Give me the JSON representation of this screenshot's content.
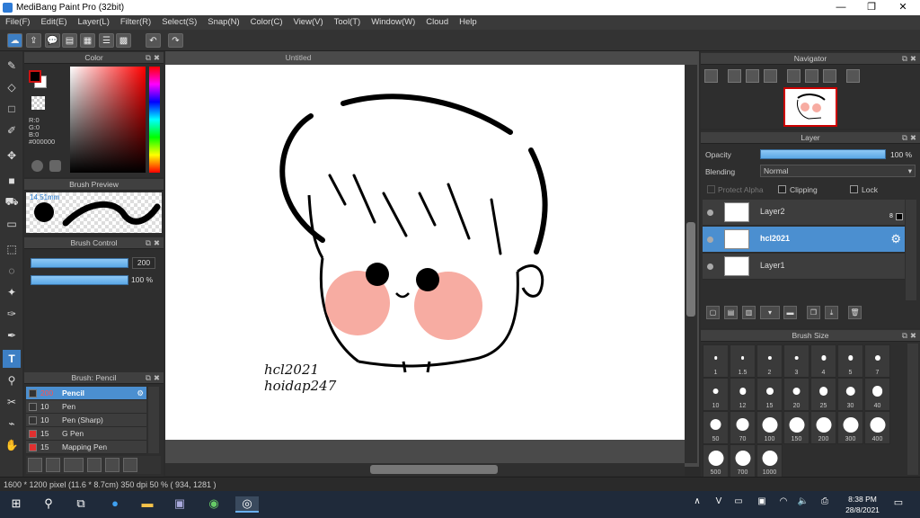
{
  "app": {
    "title": "MediBang Paint Pro (32bit)"
  },
  "window_controls": {
    "minimize": "—",
    "maximize": "❐",
    "close": "✕"
  },
  "menu": [
    "File(F)",
    "Edit(E)",
    "Layer(L)",
    "Filter(R)",
    "Select(S)",
    "Snap(N)",
    "Color(C)",
    "View(V)",
    "Tool(T)",
    "Window(W)",
    "Cloud",
    "Help"
  ],
  "document": {
    "tab": "Untitled"
  },
  "color_panel": {
    "title": "Color",
    "r": "R:0",
    "g": "G:0",
    "b": "B:0",
    "hex": "#000000",
    "primary": "#000000",
    "secondary": "#ffffff",
    "accent": "#cc1111"
  },
  "brush_preview": {
    "title": "Brush Preview",
    "size": "14.51mm"
  },
  "brush_control": {
    "title": "Brush Control",
    "size_value": "200",
    "opacity_value": "100 %",
    "size_fraction": 1.0,
    "opacity_fraction": 1.0
  },
  "brush_list": {
    "title": "Brush: Pencil",
    "items": [
      {
        "size": "200",
        "name": "Pencil",
        "selected": true,
        "color": "#333333"
      },
      {
        "size": "10",
        "name": "Pen",
        "selected": false,
        "color": "#333333"
      },
      {
        "size": "10",
        "name": "Pen (Sharp)",
        "selected": false,
        "color": "#333333"
      },
      {
        "size": "15",
        "name": "G Pen",
        "selected": false,
        "color": "#e03030"
      },
      {
        "size": "15",
        "name": "Mapping Pen",
        "selected": false,
        "color": "#e03030"
      }
    ]
  },
  "navigator": {
    "title": "Navigator"
  },
  "layer_panel": {
    "title": "Layer",
    "opacity_label": "Opacity",
    "opacity_value": "100 %",
    "blending_label": "Blending",
    "blending_value": "Normal",
    "protect_alpha": "Protect Alpha",
    "clipping": "Clipping",
    "lock": "Lock",
    "badge": "8",
    "layers": [
      {
        "name": "Layer2",
        "selected": false
      },
      {
        "name": "hcl2021",
        "selected": true
      },
      {
        "name": "Layer1",
        "selected": false
      }
    ]
  },
  "brush_size": {
    "title": "Brush Size",
    "sizes": [
      "1",
      "1.5",
      "2",
      "3",
      "4",
      "5",
      "7",
      "10",
      "12",
      "15",
      "20",
      "25",
      "30",
      "40",
      "50",
      "70",
      "100",
      "150",
      "200",
      "300",
      "400",
      "500",
      "700",
      "1000"
    ]
  },
  "canvas_text": {
    "line1": "hcl2021",
    "line2": "hoidap247"
  },
  "status": {
    "text": "1600 * 1200 pixel  (11.6 * 8.7cm)  350 dpi  50 %  ( 934, 1281 )"
  },
  "taskbar": {
    "time": "8:38 PM",
    "date": "28/8/2021"
  }
}
